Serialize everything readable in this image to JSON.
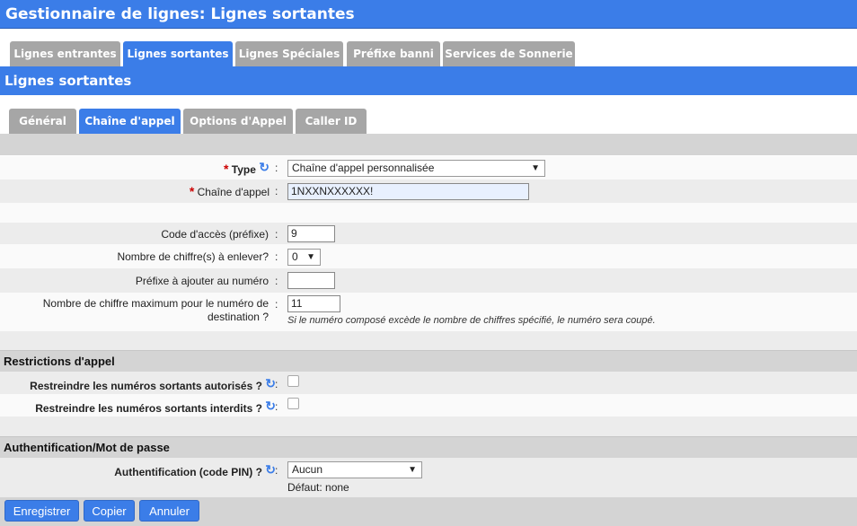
{
  "header": {
    "title": "Gestionnaire de lignes:  Lignes sortantes"
  },
  "main_tabs": [
    {
      "label": "Lignes entrantes",
      "active": false
    },
    {
      "label": "Lignes sortantes",
      "active": true
    },
    {
      "label": "Lignes Spéciales",
      "active": false
    },
    {
      "label": "Préfixe banni",
      "active": false
    },
    {
      "label": "Services de Sonnerie",
      "active": false
    }
  ],
  "section_title": "Lignes sortantes",
  "sub_tabs": [
    {
      "label": "Général",
      "active": false
    },
    {
      "label": "Chaîne d'appel",
      "active": true
    },
    {
      "label": "Options d'Appel",
      "active": false
    },
    {
      "label": "Caller ID",
      "active": false
    }
  ],
  "form": {
    "type": {
      "label": "Type",
      "value": "Chaîne d'appel personnalisée"
    },
    "chaine": {
      "label": "Chaîne d'appel",
      "value": "1NXXNXXXXXX!"
    },
    "code_acces": {
      "label": "Code d'accès (préfixe)",
      "value": "9"
    },
    "nb_chiffres": {
      "label": "Nombre de chiffre(s) à enlever?",
      "value": "0"
    },
    "prefixe": {
      "label": "Préfixe à ajouter au numéro",
      "value": ""
    },
    "max_chiffres": {
      "label_line1": "Nombre de chiffre maximum pour le numéro de",
      "label_line2": "destination ?",
      "value": "11",
      "hint": "Si le numéro composé excède le nombre de chiffres spécifié, le numéro sera coupé."
    }
  },
  "restrictions": {
    "title": "Restrictions d'appel",
    "autorises": {
      "label": "Restreindre les numéros sortants autorisés ?",
      "checked": false
    },
    "interdits": {
      "label": "Restreindre les numéros sortants interdits ?",
      "checked": false
    }
  },
  "auth": {
    "title": "Authentification/Mot de passe",
    "label": "Authentification (code PIN) ?",
    "value": "Aucun",
    "default_text": "Défaut: none"
  },
  "buttons": {
    "save": "Enregistrer",
    "copy": "Copier",
    "cancel": "Annuler"
  },
  "symbols": {
    "colon": ":",
    "required": "*",
    "refresh_icon": "↻",
    "dropdown_arrow": "▼"
  }
}
